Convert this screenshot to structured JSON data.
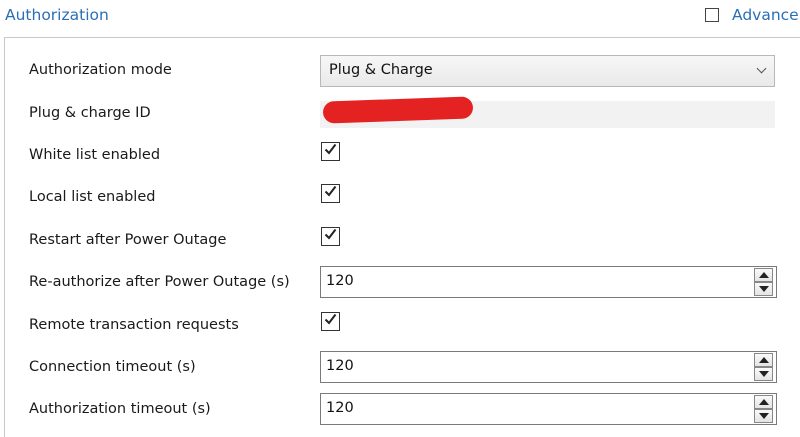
{
  "section": {
    "title": "Authorization",
    "advanced_label": "Advance",
    "advanced_checked": false
  },
  "fields": {
    "authorization_mode": {
      "label": "Authorization mode",
      "value": "Plug & Charge"
    },
    "plug_charge_id": {
      "label": "Plug & charge ID"
    },
    "white_list": {
      "label": "White list enabled",
      "checked": true
    },
    "local_list": {
      "label": "Local list enabled",
      "checked": true
    },
    "restart_after_outage": {
      "label": "Restart after Power Outage",
      "checked": true
    },
    "reauthorize_after_outage": {
      "label": "Re-authorize after Power Outage (s)",
      "value": "120"
    },
    "remote_transaction": {
      "label": "Remote transaction requests",
      "checked": true
    },
    "connection_timeout": {
      "label": "Connection timeout (s)",
      "value": "120"
    },
    "authorization_timeout": {
      "label": "Authorization timeout (s)",
      "value": "120"
    }
  },
  "colors": {
    "accent": "#2a6fb8",
    "redaction": "#e52222"
  }
}
